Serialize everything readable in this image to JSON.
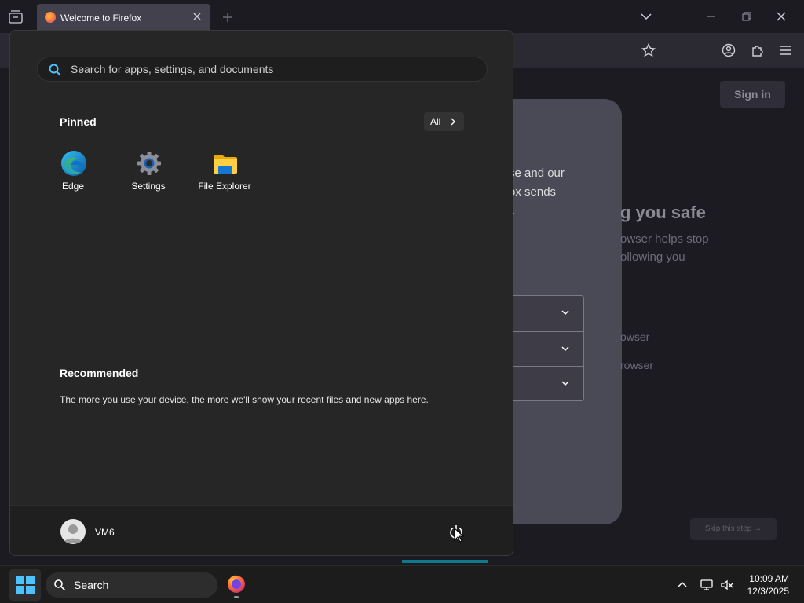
{
  "firefox": {
    "tab_title": "Welcome to Firefox",
    "sign_in_label": "Sign in",
    "content_line1": "se and our",
    "content_line2": "ox sends",
    "content_line3": ".",
    "heading": "g you safe",
    "sub_line1": "owser helps stop",
    "sub_line2": "ollowing you",
    "option_line1": "owser",
    "option_line2": "rowser",
    "skip_label": "Skip this step →"
  },
  "start_menu": {
    "search_placeholder": "Search for apps, settings, and documents",
    "pinned_title": "Pinned",
    "all_label": "All",
    "pinned_apps": [
      {
        "label": "Edge",
        "icon": "edge-icon"
      },
      {
        "label": "Settings",
        "icon": "settings-gear-icon"
      },
      {
        "label": "File Explorer",
        "icon": "folder-icon"
      }
    ],
    "recommended_title": "Recommended",
    "recommended_text": "The more you use your device, the more we'll show your recent files and new apps here.",
    "user_name": "VM6"
  },
  "taskbar": {
    "search_label": "Search",
    "time": "10:09 AM",
    "date": "12/3/2025"
  },
  "colors": {
    "accent": "#0078d4",
    "start_menu_bg": "#262626",
    "taskbar_bg": "#1c1c1c",
    "firefox_bg": "#1c1b22"
  }
}
